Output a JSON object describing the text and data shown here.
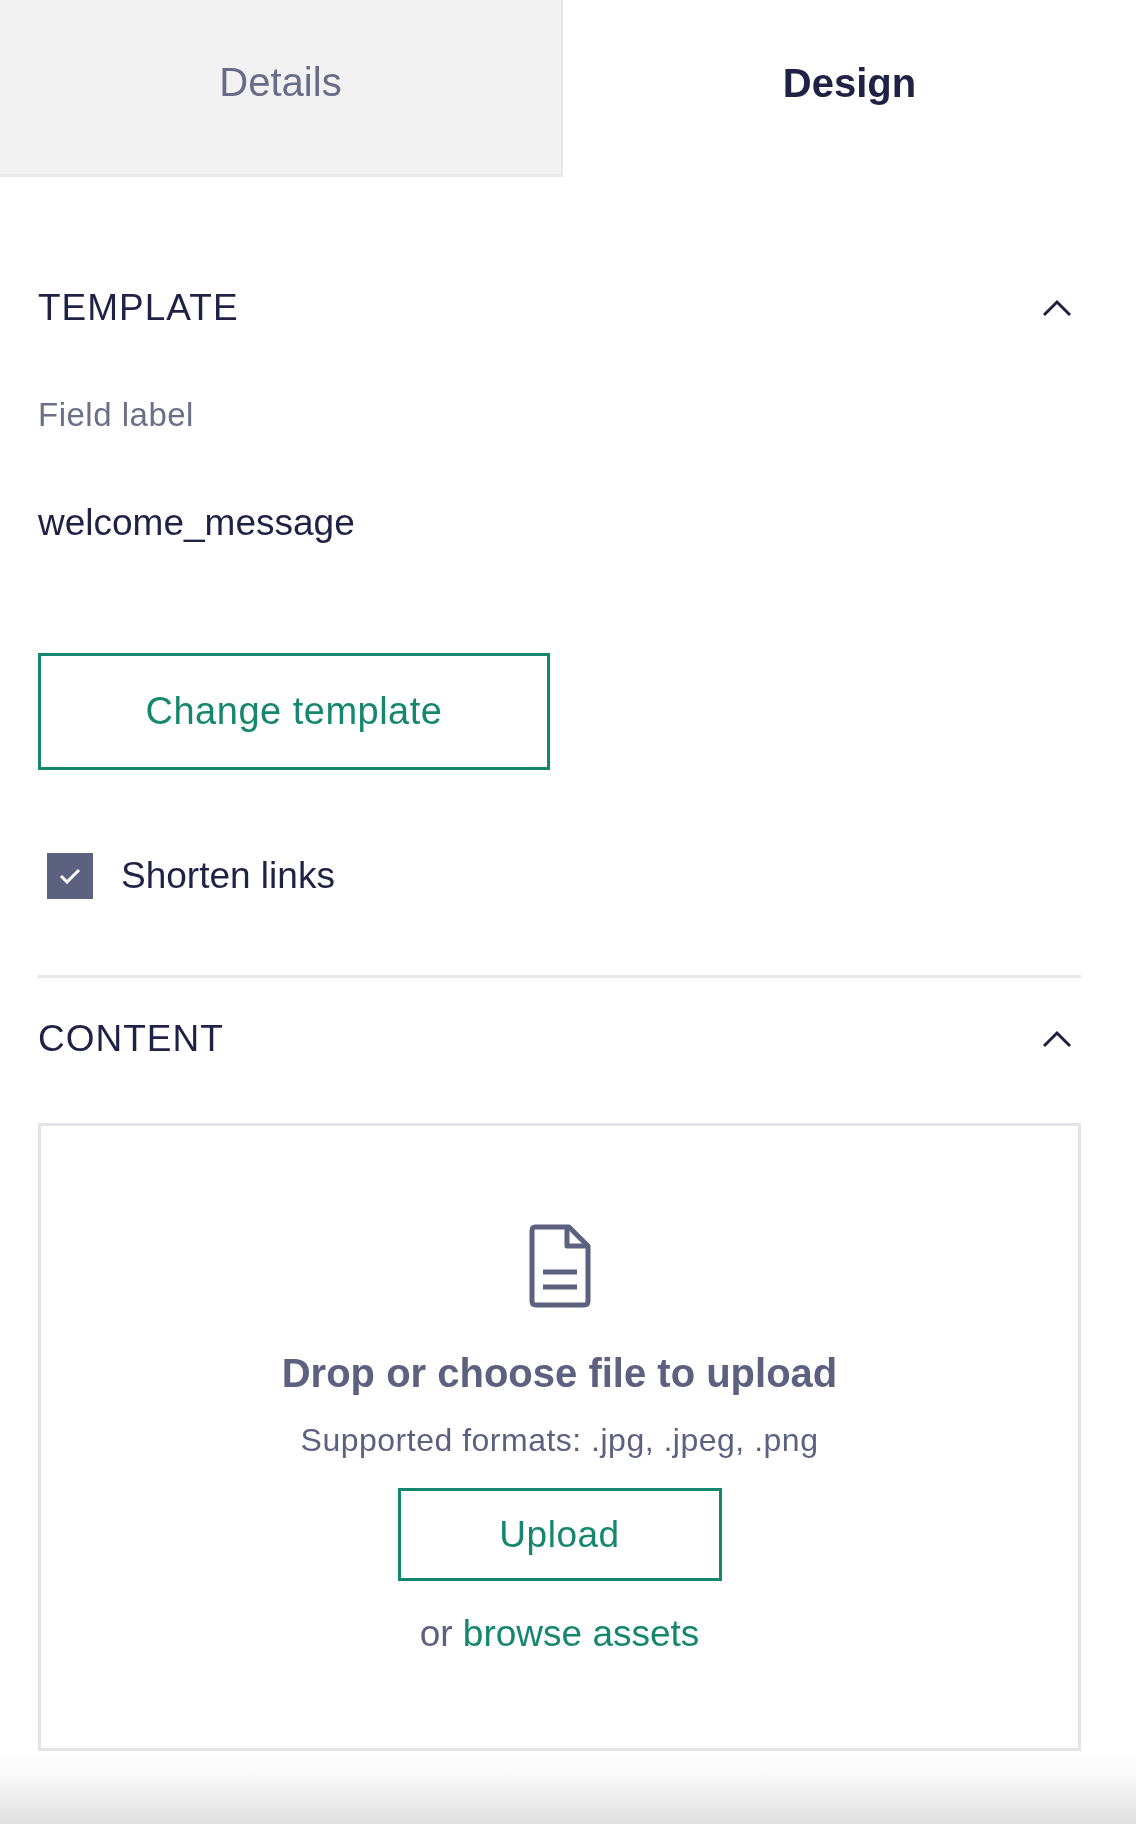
{
  "tabs": [
    {
      "label": "Details",
      "selected": false
    },
    {
      "label": "Design",
      "selected": true
    }
  ],
  "sections": [
    {
      "kind": "template",
      "title": "TEMPLATE",
      "expanded": true,
      "field_label": "Field label",
      "field_value": "welcome_message",
      "button": "Change template",
      "checkbox": {
        "label": "Shorten links",
        "checked": true
      }
    },
    {
      "kind": "upload",
      "title": "CONTENT",
      "expanded": true,
      "dropzone": {
        "title": "Drop or choose file to upload",
        "formats": "Supported formats: .jpg, .jpeg, .png",
        "button": "Upload",
        "alt_prefix": "or",
        "alt_link": "browse assets"
      }
    }
  ]
}
